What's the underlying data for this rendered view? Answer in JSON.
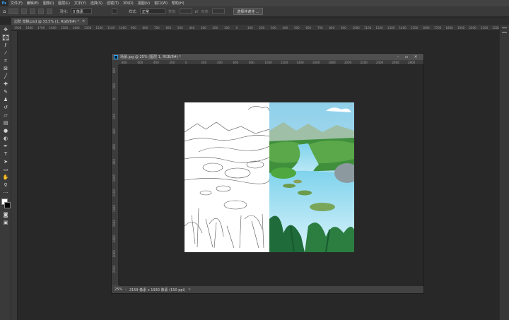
{
  "app": {
    "logo": "Ps"
  },
  "menu": [
    "文件(F)",
    "编辑(E)",
    "图像(I)",
    "图层(L)",
    "文字(Y)",
    "选择(S)",
    "滤镜(T)",
    "3D(D)",
    "视图(V)",
    "窗口(W)",
    "帮助(H)"
  ],
  "options": {
    "feather_label": "羽化:",
    "feather_value": "0 像素",
    "style_label": "样式:",
    "style_value": "正常",
    "width_label": "宽度:",
    "height_label": "高度:",
    "select_mask_button": "选择并遮住 ..."
  },
  "doc_tab": {
    "title": "边防 草稿.psd @ 33.5% (1, RGB/8#) *",
    "close": "×"
  },
  "main_ruler": [
    "1900",
    "1800",
    "1700",
    "1600",
    "1500",
    "1400",
    "1300",
    "1200",
    "1100",
    "1000",
    "900",
    "800",
    "700",
    "600",
    "500",
    "400",
    "300",
    "200",
    "100",
    "0",
    "100",
    "200",
    "300",
    "400",
    "500",
    "600",
    "700",
    "800",
    "900",
    "1000",
    "1100",
    "1200",
    "1300",
    "1400",
    "1500",
    "1600",
    "1700",
    "1800",
    "1900",
    "2000",
    "2100",
    "2200"
  ],
  "doc_window": {
    "title": "场景.jpg @ 25% (图层 1, RGB/8#) *",
    "ruler_h": [
      "800",
      "600",
      "400",
      "200",
      "0",
      "200",
      "400",
      "600",
      "800",
      "1000",
      "1200",
      "1400",
      "1600",
      "1800",
      "2000",
      "2200",
      "2400",
      "2600",
      "2800"
    ],
    "ruler_v": [
      "400",
      "200",
      "0",
      "200",
      "400",
      "600",
      "800",
      "1000",
      "1200",
      "1400",
      "1600",
      "1800",
      "2000",
      "2200"
    ],
    "zoom": "25%",
    "doc_info": "2159 像素 x 1930 像素 (150 ppi)",
    "status_arrow": ">"
  },
  "icons": {
    "menu": "hamburger-icon",
    "tools": [
      "move-tool-icon",
      "marquee-tool-icon",
      "lasso-tool-icon",
      "magic-wand-icon",
      "crop-tool-icon",
      "frame-tool-icon",
      "eyedropper-icon",
      "healing-brush-icon",
      "brush-tool-icon",
      "clone-stamp-icon",
      "history-brush-icon",
      "eraser-icon",
      "gradient-tool-icon",
      "blur-tool-icon",
      "dodge-tool-icon",
      "pen-tool-icon",
      "type-tool-icon",
      "path-select-icon",
      "shape-tool-icon",
      "hand-tool-icon",
      "zoom-tool-icon",
      "more-tools-icon",
      "color-swatches-icon",
      "quick-mask-icon",
      "screen-mode-icon"
    ]
  },
  "colors": {
    "foreground": "#ffffff",
    "background": "#000000",
    "accent": "#31a8ff"
  }
}
